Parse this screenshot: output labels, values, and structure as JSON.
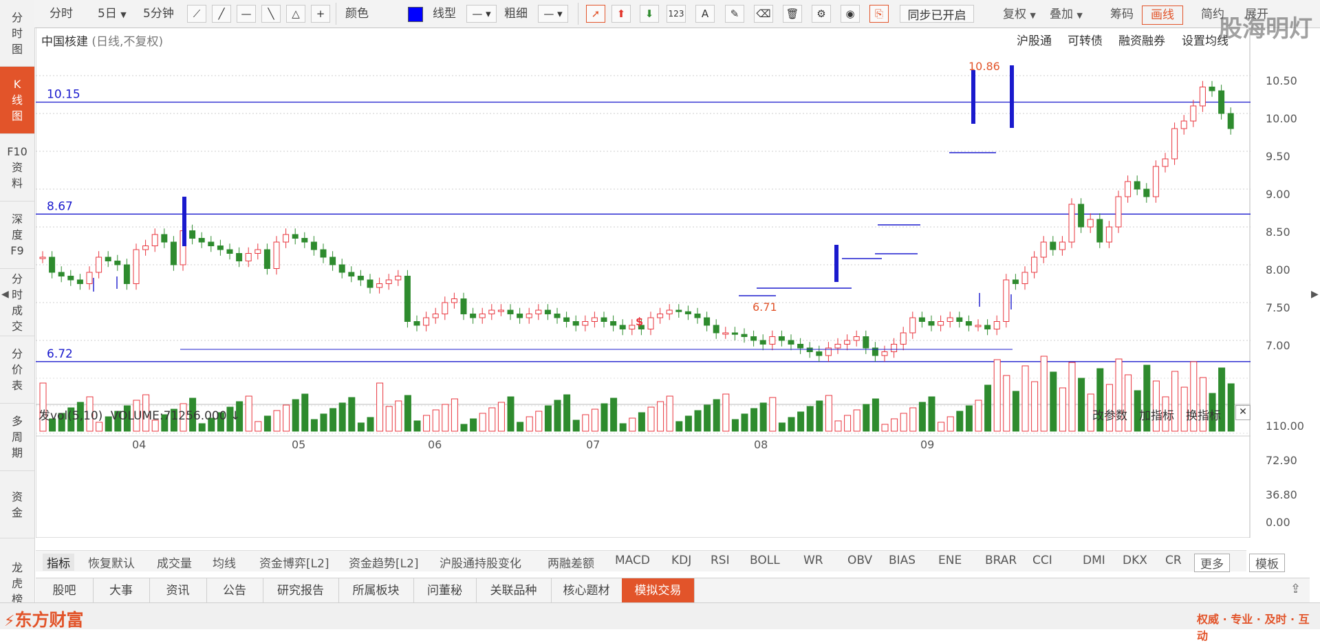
{
  "left_tabs": [
    {
      "label": "分\n时\n图",
      "name": "tab-intraday"
    },
    {
      "label": "K\n线\n图",
      "name": "tab-kline"
    },
    {
      "label": "F10\n资\n料",
      "name": "tab-f10"
    },
    {
      "label": "深\n度\nF9",
      "name": "tab-f9"
    },
    {
      "label": "分\n时\n成\n交",
      "name": "tab-trades"
    },
    {
      "label": "分\n价\n表",
      "name": "tab-price-table"
    },
    {
      "label": "多\n周\n期",
      "name": "tab-multi-period"
    },
    {
      "label": "资\n金",
      "name": "tab-funds"
    },
    {
      "label": "龙\n虎\n榜",
      "name": "tab-dragon-tiger"
    }
  ],
  "toolbar": {
    "period_intraday": "分时",
    "period_5day": "5日",
    "period_5min": "5分钟",
    "color_label": "颜色",
    "color_value": "#0000ff",
    "linetype_label": "线型",
    "width_label": "粗细",
    "sync_label": "同步已开启",
    "fuquan_label": "复权",
    "overlay_label": "叠加",
    "chip_label": "筹码",
    "draw_label": "画线",
    "simple_label": "简约",
    "expand_label": "展开"
  },
  "header": {
    "stock_name": "中国核建",
    "stock_mode": "(日线,不复权)",
    "links": [
      "沪股通",
      "可转债",
      "融资融券",
      "设置均线"
    ],
    "watermark": "股海明灯"
  },
  "price_axis": [
    "10.50",
    "10.00",
    "9.50",
    "9.00",
    "8.50",
    "8.00",
    "7.50",
    "7.00"
  ],
  "hlines": [
    {
      "label": "10.15",
      "color": "#1a1acd"
    },
    {
      "label": "8.67",
      "color": "#1a1acd"
    },
    {
      "label": "6.72",
      "color": "#1a1acd"
    }
  ],
  "annotations": {
    "high": "10.86",
    "low": "6.71",
    "marker": "$"
  },
  "volume": {
    "title": "发vol(5,10)",
    "value_label": "VOLUME:71256.000",
    "axis": [
      "110.00",
      "72.90",
      "36.80",
      "0.00"
    ],
    "buttons": [
      "改参数",
      "加指标",
      "换指标"
    ]
  },
  "date_axis": [
    "04",
    "05",
    "06",
    "07",
    "08",
    "09"
  ],
  "indicator_tabs": [
    "指标",
    "恢复默认",
    "成交量",
    "均线",
    "资金博弈[L2]",
    "资金趋势[L2]",
    "沪股通持股变化",
    "两融差额",
    "MACD",
    "KDJ",
    "RSI",
    "BOLL",
    "WR",
    "OBV",
    "BIAS",
    "ENE",
    "BRAR",
    "CCI",
    "DMI",
    "DKX",
    "CR",
    "更多",
    "模板"
  ],
  "bottom_tabs": [
    "股吧",
    "大事",
    "资讯",
    "公告",
    "研究报告",
    "所属板块",
    "问董秘",
    "关联品种",
    "核心题材",
    "模拟交易"
  ],
  "footer": {
    "brand": "东方财富",
    "slogan": "权威 · 专业 · 及时 · 互动"
  },
  "colors": {
    "up": "#e8343c",
    "down": "#2e8b2e",
    "accent": "#e2542a",
    "line": "#1a1acd"
  }
}
